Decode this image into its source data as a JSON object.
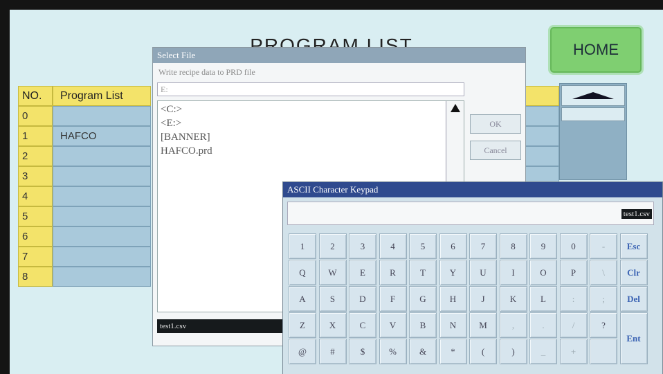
{
  "page": {
    "title": "PROGRAM LIST",
    "home_label": "HOME"
  },
  "table": {
    "header_no": "NO.",
    "header_list": "Program List",
    "rows": [
      {
        "no": "0",
        "name": ""
      },
      {
        "no": "1",
        "name": "HAFCO"
      },
      {
        "no": "2",
        "name": ""
      },
      {
        "no": "3",
        "name": ""
      },
      {
        "no": "4",
        "name": ""
      },
      {
        "no": "5",
        "name": ""
      },
      {
        "no": "6",
        "name": ""
      },
      {
        "no": "7",
        "name": ""
      },
      {
        "no": "8",
        "name": ""
      }
    ]
  },
  "select_file": {
    "title": "Select File",
    "subtitle": "Write recipe data to PRD file",
    "path": "E:",
    "items": [
      "<C:>",
      "<E:>",
      "[BANNER]",
      "HAFCO.prd"
    ],
    "ok_label": "OK",
    "cancel_label": "Cancel",
    "filename": "test1.csv"
  },
  "keypad": {
    "title": "ASCII Character Keypad",
    "display_value": "test1.csv",
    "rows": [
      [
        "1",
        "2",
        "3",
        "4",
        "5",
        "6",
        "7",
        "8",
        "9",
        "0",
        "-",
        "Esc"
      ],
      [
        "Q",
        "W",
        "E",
        "R",
        "T",
        "Y",
        "U",
        "I",
        "O",
        "P",
        "\\",
        "Clr"
      ],
      [
        "A",
        "S",
        "D",
        "F",
        "G",
        "H",
        "J",
        "K",
        "L",
        ":",
        ";",
        "Del"
      ],
      [
        "Z",
        "X",
        "C",
        "V",
        "B",
        "N",
        "M",
        ",",
        ".",
        "/",
        "?",
        "Ent"
      ],
      [
        "@",
        "#",
        "$",
        "%",
        "&",
        "*",
        "(",
        ")",
        "_",
        "+"
      ]
    ]
  }
}
